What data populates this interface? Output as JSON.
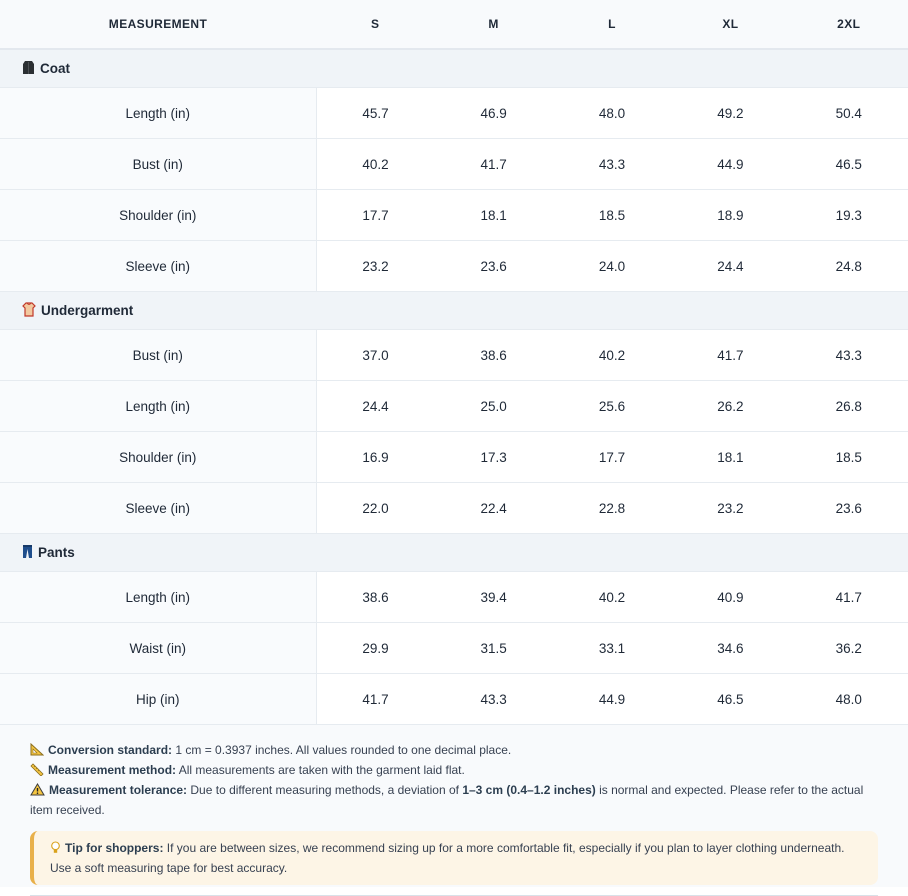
{
  "header": {
    "measurement": "MEASUREMENT",
    "sizes": [
      "S",
      "M",
      "L",
      "XL",
      "2XL"
    ]
  },
  "sections": [
    {
      "title": "Coat",
      "icon": "coat-icon",
      "rows": [
        {
          "label": "Length (in)",
          "values": [
            "45.7",
            "46.9",
            "48.0",
            "49.2",
            "50.4"
          ]
        },
        {
          "label": "Bust (in)",
          "values": [
            "40.2",
            "41.7",
            "43.3",
            "44.9",
            "46.5"
          ]
        },
        {
          "label": "Shoulder (in)",
          "values": [
            "17.7",
            "18.1",
            "18.5",
            "18.9",
            "19.3"
          ]
        },
        {
          "label": "Sleeve (in)",
          "values": [
            "23.2",
            "23.6",
            "24.0",
            "24.4",
            "24.8"
          ]
        }
      ]
    },
    {
      "title": "Undergarment",
      "icon": "shirt-icon",
      "rows": [
        {
          "label": "Bust (in)",
          "values": [
            "37.0",
            "38.6",
            "40.2",
            "41.7",
            "43.3"
          ]
        },
        {
          "label": "Length (in)",
          "values": [
            "24.4",
            "25.0",
            "25.6",
            "26.2",
            "26.8"
          ]
        },
        {
          "label": "Shoulder (in)",
          "values": [
            "16.9",
            "17.3",
            "17.7",
            "18.1",
            "18.5"
          ]
        },
        {
          "label": "Sleeve (in)",
          "values": [
            "22.0",
            "22.4",
            "22.8",
            "23.2",
            "23.6"
          ]
        }
      ]
    },
    {
      "title": "Pants",
      "icon": "pants-icon",
      "rows": [
        {
          "label": "Length (in)",
          "values": [
            "38.6",
            "39.4",
            "40.2",
            "40.9",
            "41.7"
          ]
        },
        {
          "label": "Waist (in)",
          "values": [
            "29.9",
            "31.5",
            "33.1",
            "34.6",
            "36.2"
          ]
        },
        {
          "label": "Hip (in)",
          "values": [
            "41.7",
            "43.3",
            "44.9",
            "46.5",
            "48.0"
          ]
        }
      ]
    }
  ],
  "notes": {
    "conversion": {
      "icon": "ruler-triangle-icon",
      "label": "Conversion standard:",
      "text": " 1 cm = 0.3937 inches. All values rounded to one decimal place."
    },
    "method": {
      "icon": "ruler-icon",
      "label": "Measurement method:",
      "text": " All measurements are taken with the garment laid flat."
    },
    "tolerance": {
      "icon": "warning-icon",
      "label": "Measurement tolerance:",
      "text_before": " Due to different measuring methods, a deviation of ",
      "range": "1–3 cm (0.4–1.2 inches)",
      "text_after": " is normal and expected. Please refer to the actual item received."
    },
    "tip": {
      "icon": "lightbulb-icon",
      "label": "Tip for shoppers:",
      "text": " If you are between sizes, we recommend sizing up for a more comfortable fit, especially if you plan to layer clothing underneath. Use a soft measuring tape for best accuracy."
    }
  },
  "colors": {
    "header_bg": "#f8fafc",
    "section_bg": "#f0f4f8",
    "tip_bg": "#fdf5e6",
    "tip_border": "#e8b04a"
  }
}
